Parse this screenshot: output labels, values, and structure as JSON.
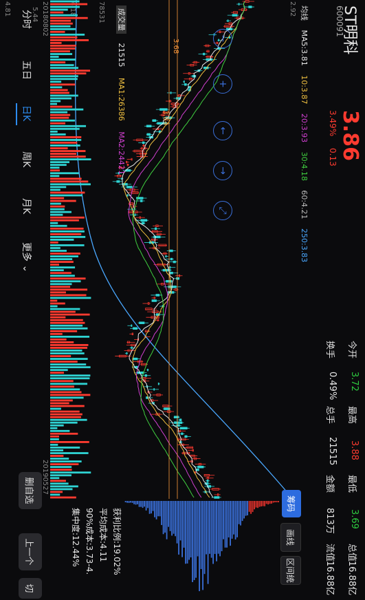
{
  "stock": {
    "name": "ST明科",
    "code": "600091",
    "price": "3.86",
    "change_pct": "3.49%",
    "change_abs": "0.13"
  },
  "quote": [
    {
      "label": "今开",
      "value": "3.72",
      "color": "green"
    },
    {
      "label": "最高",
      "value": "3.88",
      "color": "red"
    },
    {
      "label": "最低",
      "value": "3.69",
      "color": "green"
    },
    {
      "label": "总值",
      "value": "16.88亿",
      "color": "white"
    },
    {
      "label": "换手",
      "value": "0.49%",
      "color": "white"
    },
    {
      "label": "总手",
      "value": "21515",
      "color": "white"
    },
    {
      "label": "金额",
      "value": "813万",
      "color": "white"
    },
    {
      "label": "流值",
      "value": "16.88亿",
      "color": "white"
    }
  ],
  "ma_row": {
    "label": "均线",
    "ma5": "MA5:3.81",
    "ma10": "10:3.87",
    "ma20": "20:3.93",
    "ma30": "30:4.18",
    "ma60": "60:4.21",
    "ma250": "250:3.83"
  },
  "axis": {
    "p1": "4.81",
    "p2": "4.18",
    "p3": "2.92",
    "p4": "5.44",
    "mark1": "3.68",
    "mark2": "3.84"
  },
  "volume": {
    "badge": "成交量",
    "vol": "21515",
    "ma1": "MA1:26386",
    "ma2": "MA2:24421",
    "vmax": "78531"
  },
  "dates": {
    "start": "20180802",
    "end": "20190527"
  },
  "chip": {
    "tab1": "筹码",
    "tab2": "画线",
    "tab3": "区间统",
    "profit": "获利比例:19.02%",
    "avg_cost": "平均成本:4.11",
    "cost90": "90%成本:3.73-4.",
    "concentration": "集中度:12.44%"
  },
  "tabs": [
    "分时",
    "五日",
    "日K",
    "周K",
    "月K",
    "更多"
  ],
  "side": {
    "del": "删自选",
    "prev": "上一个",
    "next": "切"
  },
  "colors": {
    "red": "#ff3b30",
    "green": "#2ecc40",
    "blue": "#2d6cdf"
  }
}
